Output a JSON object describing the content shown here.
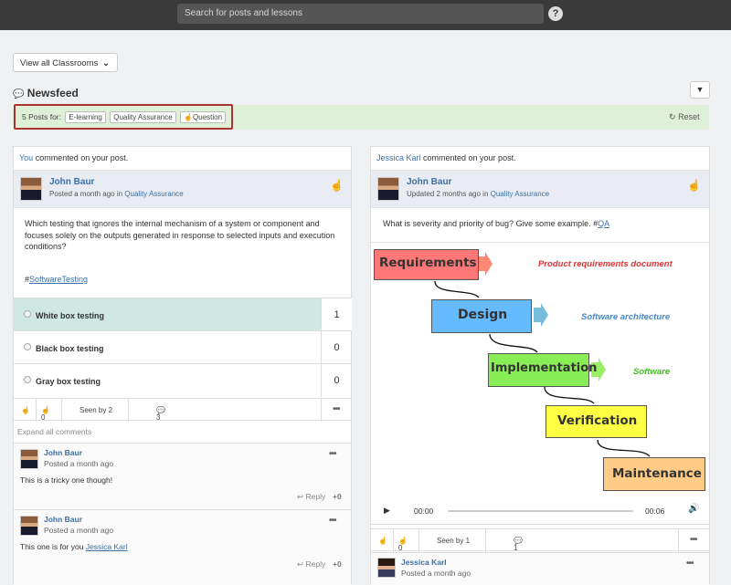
{
  "topbar": {
    "search_placeholder": "Search for posts and lessons",
    "help": "?"
  },
  "classroom_button": "View all Classrooms",
  "newsfeed_title": "Newsfeed",
  "filter": {
    "prefix": "5 Posts for:",
    "tags": [
      "E-learning",
      "Quality Assurance",
      "Question"
    ],
    "reset": "Reset"
  },
  "post1": {
    "activity_actor": "You",
    "activity_text": " commented on your post.",
    "author": "John Baur",
    "meta_prefix": "Posted a month ago in ",
    "category": "Quality Assurance",
    "body": "Which testing that ignores the internal mechanism of a system or component and focuses solely on the outputs generated in response to selected inputs and execution conditions?",
    "hashtag_prefix": "#",
    "hashtag": "SoftwareTesting",
    "options": [
      {
        "label": "White box testing",
        "count": "1"
      },
      {
        "label": "Black box testing",
        "count": "0"
      },
      {
        "label": "Gray box testing",
        "count": "0"
      }
    ],
    "likes": "0",
    "seen": "Seen by 2",
    "comments_count": "3",
    "expand": "Expand all comments",
    "comments": [
      {
        "author": "John Baur",
        "time": "Posted a month ago",
        "text": "This is a tricky one though!",
        "mention": "",
        "reply": "Reply",
        "score": "+0"
      },
      {
        "author": "John Baur",
        "time": "Posted a month ago",
        "text": "This one is for you ",
        "mention": "Jessica Karl",
        "reply": "Reply",
        "score": "+0"
      }
    ]
  },
  "post2": {
    "activity_actor": "Jessica Karl",
    "activity_text": " commented on your post.",
    "author": "John Baur",
    "meta_prefix": "Updated 2 months ago in ",
    "category": "Quality Assurance",
    "body": "What is severity and priority of bug? Give some example. #",
    "hashtag": "QA",
    "diagram": {
      "steps": [
        "Requirements",
        "Design",
        "Implementation",
        "Verification",
        "Maintenance"
      ],
      "outputs": [
        "Product requirements document",
        "Software architecture",
        "Software"
      ]
    },
    "video": {
      "current": "00:00",
      "duration": "00:06"
    },
    "likes": "0",
    "seen": "Seen by 1",
    "comments_count": "1",
    "comment": {
      "author": "Jessica Karl",
      "time": "Posted a month ago"
    }
  }
}
